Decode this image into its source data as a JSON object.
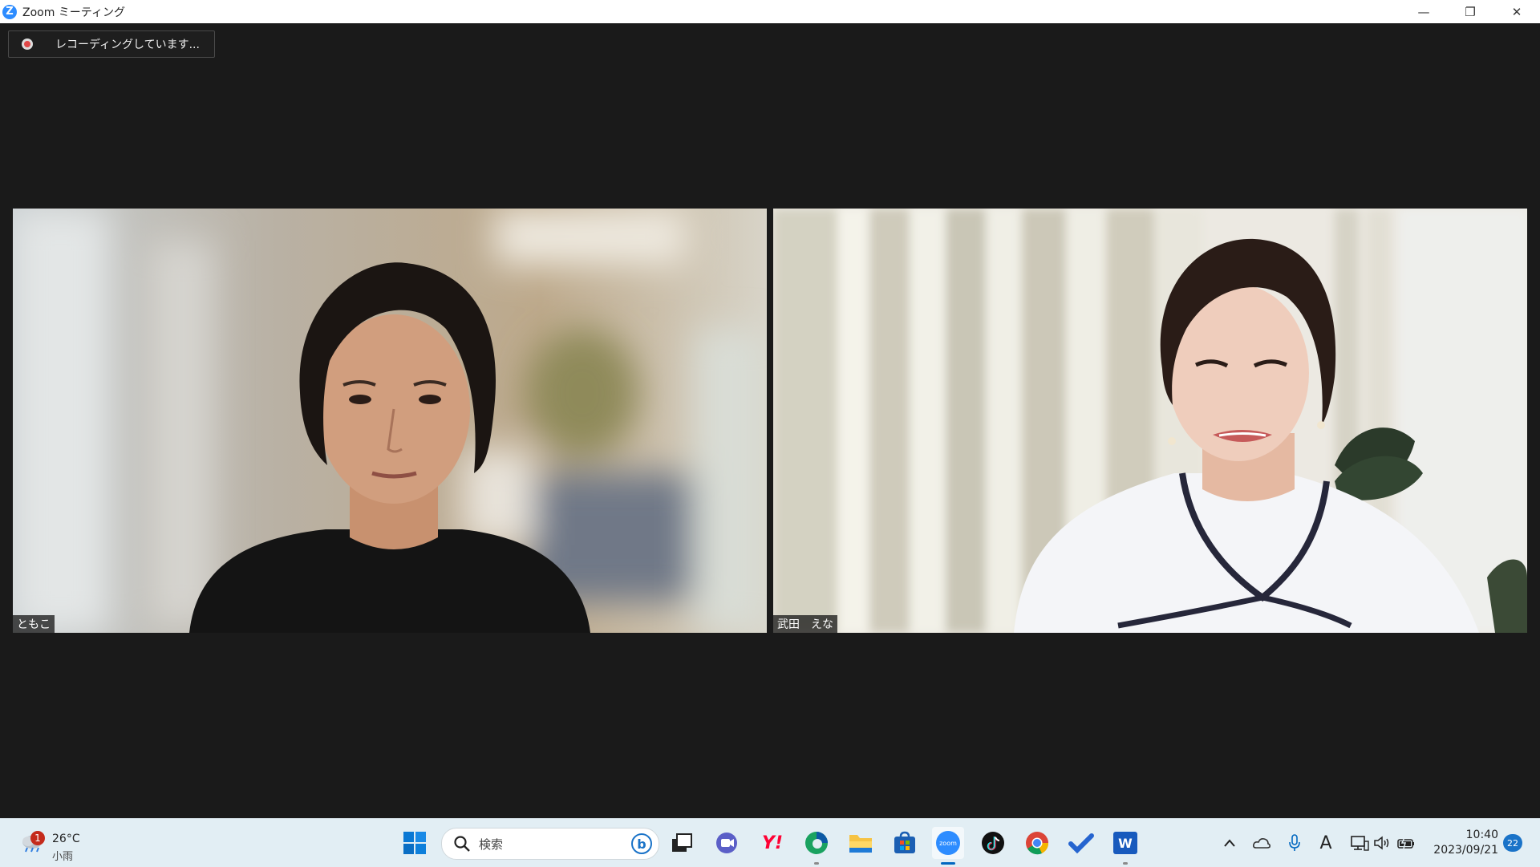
{
  "window": {
    "title": "Zoom ミーティング",
    "logo_letter": "Z",
    "minimize_glyph": "—",
    "restore_glyph": "❐",
    "close_glyph": "✕"
  },
  "recording": {
    "label": "レコーディングしています..."
  },
  "participants": [
    {
      "name": "ともこ"
    },
    {
      "name": "武田　えな"
    }
  ],
  "taskbar": {
    "weather": {
      "badge": "1",
      "temp": "26°C",
      "condition": "小雨"
    },
    "search_placeholder": "検索",
    "apps": [
      "windows-start",
      "task-view",
      "teams-chat",
      "yahoo",
      "edge",
      "file-explorer",
      "store",
      "zoom",
      "tiktok",
      "chrome",
      "todo",
      "word"
    ],
    "yahoo_label": "Y!",
    "zoom_label": "zoom",
    "word_label": "W",
    "ime_label": "A",
    "clock_time": "10:40",
    "clock_date": "2023/09/21",
    "notifications": "22"
  },
  "colors": {
    "background": "#1a1a1a",
    "zoom_blue": "#2d8cff",
    "taskbar": "#e2eef4",
    "recording_red": "#e04848"
  }
}
